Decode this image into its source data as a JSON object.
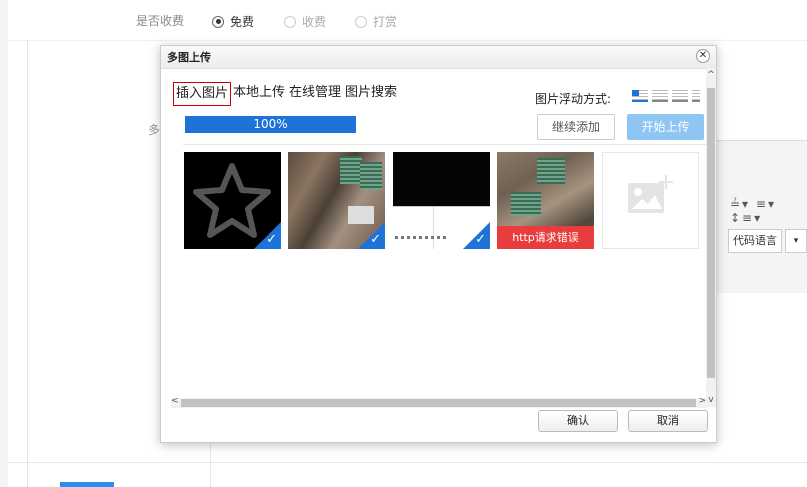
{
  "background": {
    "fee_label": "是否收费",
    "fee_options": [
      {
        "label": "免费",
        "selected": true
      },
      {
        "label": "收费",
        "selected": false
      },
      {
        "label": "打赏",
        "selected": false
      }
    ],
    "left_label": "多",
    "editor": {
      "code_language": "代码语言",
      "code_dropdown": "▾",
      "toolbar_glyphs": "≟▾ ≡▾ ↕≡▾"
    }
  },
  "dialog": {
    "title": "多图上传",
    "close_glyph": "✕",
    "tabs": [
      {
        "label": "插入图片",
        "active": true
      },
      {
        "label": "本地上传",
        "active": false
      },
      {
        "label": "在线管理",
        "active": false
      },
      {
        "label": "图片搜索",
        "active": false
      }
    ],
    "float_label": "图片浮动方式:",
    "float_icons": [
      "float-none-icon",
      "float-left-icon",
      "float-right-icon",
      "float-center-icon"
    ],
    "progress": {
      "percent": 100,
      "text": "100%"
    },
    "continue_button": "继续添加",
    "start_button": "开始上传",
    "images": [
      {
        "name": "star-image",
        "checked": true
      },
      {
        "name": "building-image",
        "checked": true
      },
      {
        "name": "screenshot-image",
        "checked": true
      },
      {
        "name": "balcony-image",
        "checked": false,
        "error": "http请求错误"
      }
    ],
    "scroll": {
      "up": "^",
      "down": "v",
      "left": "<",
      "right": ">"
    },
    "ok_button": "确认",
    "cancel_button": "取消"
  },
  "colors": {
    "accent": "#1e73d6",
    "error": "#e93c3c",
    "start_button": "#8ec5f3"
  }
}
